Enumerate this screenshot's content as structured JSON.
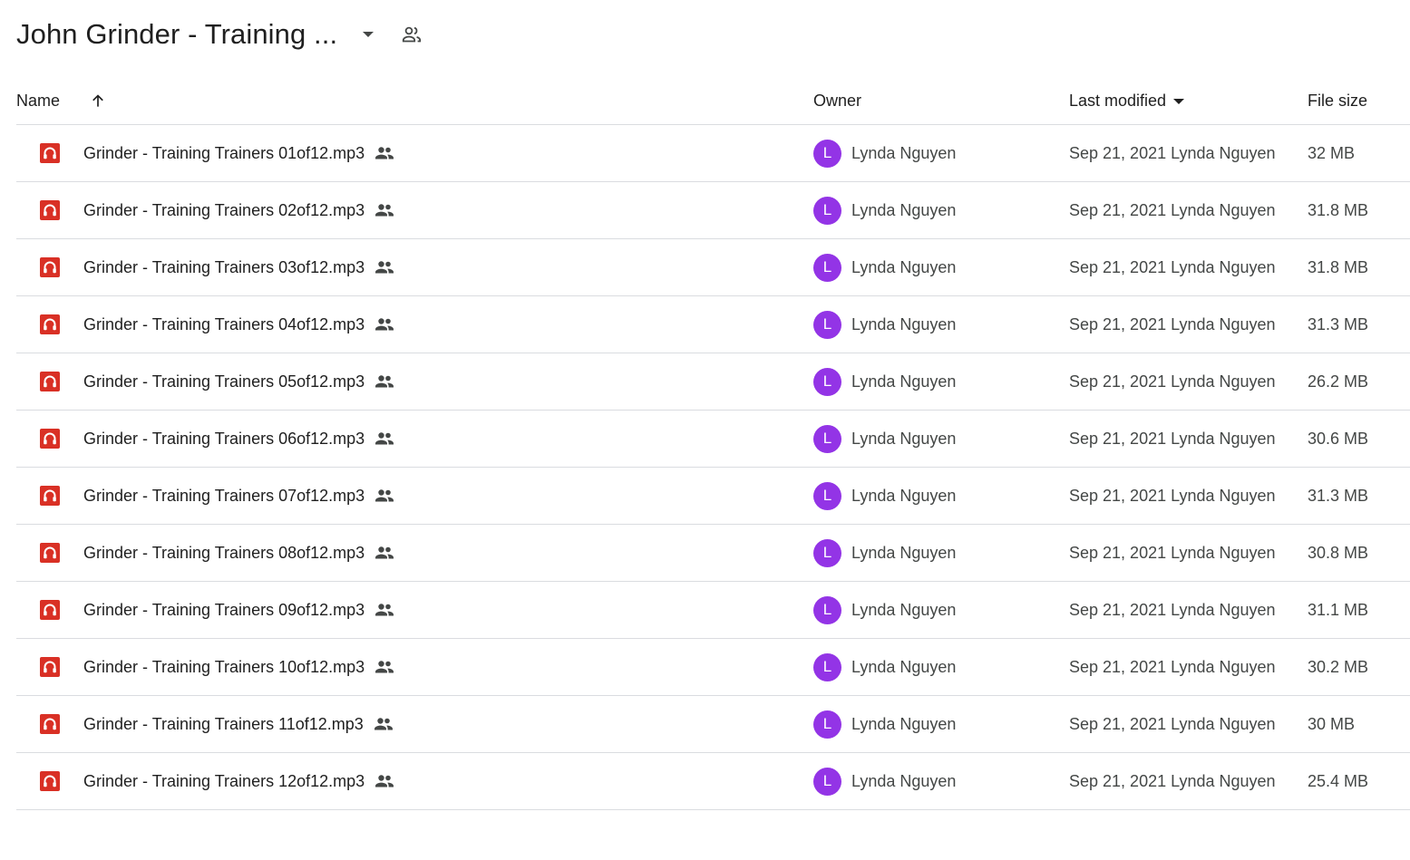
{
  "header": {
    "title": "John Grinder - Training ...",
    "dropdown_icon": "arrow-drop-down-icon",
    "shared_icon": "people-outline-icon"
  },
  "columns": {
    "name": "Name",
    "owner": "Owner",
    "last_modified": "Last modified",
    "file_size": "File size",
    "sort_icon": "arrow-up-icon"
  },
  "colors": {
    "audio_icon": "#d93025",
    "avatar": "#9334e6",
    "divider": "#dadce0"
  },
  "rows": [
    {
      "name": "Grinder - Training Trainers 01of12.mp3",
      "owner_initial": "L",
      "owner": "Lynda Nguyen",
      "modified": "Sep 21, 2021 Lynda Nguyen",
      "size": "32 MB"
    },
    {
      "name": "Grinder - Training Trainers 02of12.mp3",
      "owner_initial": "L",
      "owner": "Lynda Nguyen",
      "modified": "Sep 21, 2021 Lynda Nguyen",
      "size": "31.8 MB"
    },
    {
      "name": "Grinder - Training Trainers 03of12.mp3",
      "owner_initial": "L",
      "owner": "Lynda Nguyen",
      "modified": "Sep 21, 2021 Lynda Nguyen",
      "size": "31.8 MB"
    },
    {
      "name": "Grinder - Training Trainers 04of12.mp3",
      "owner_initial": "L",
      "owner": "Lynda Nguyen",
      "modified": "Sep 21, 2021 Lynda Nguyen",
      "size": "31.3 MB"
    },
    {
      "name": "Grinder - Training Trainers 05of12.mp3",
      "owner_initial": "L",
      "owner": "Lynda Nguyen",
      "modified": "Sep 21, 2021 Lynda Nguyen",
      "size": "26.2 MB"
    },
    {
      "name": "Grinder - Training Trainers 06of12.mp3",
      "owner_initial": "L",
      "owner": "Lynda Nguyen",
      "modified": "Sep 21, 2021 Lynda Nguyen",
      "size": "30.6 MB"
    },
    {
      "name": "Grinder - Training Trainers 07of12.mp3",
      "owner_initial": "L",
      "owner": "Lynda Nguyen",
      "modified": "Sep 21, 2021 Lynda Nguyen",
      "size": "31.3 MB"
    },
    {
      "name": "Grinder - Training Trainers 08of12.mp3",
      "owner_initial": "L",
      "owner": "Lynda Nguyen",
      "modified": "Sep 21, 2021 Lynda Nguyen",
      "size": "30.8 MB"
    },
    {
      "name": "Grinder - Training Trainers 09of12.mp3",
      "owner_initial": "L",
      "owner": "Lynda Nguyen",
      "modified": "Sep 21, 2021 Lynda Nguyen",
      "size": "31.1 MB"
    },
    {
      "name": "Grinder - Training Trainers 10of12.mp3",
      "owner_initial": "L",
      "owner": "Lynda Nguyen",
      "modified": "Sep 21, 2021 Lynda Nguyen",
      "size": "30.2 MB"
    },
    {
      "name": "Grinder - Training Trainers 11of12.mp3",
      "owner_initial": "L",
      "owner": "Lynda Nguyen",
      "modified": "Sep 21, 2021 Lynda Nguyen",
      "size": "30 MB"
    },
    {
      "name": "Grinder - Training Trainers 12of12.mp3",
      "owner_initial": "L",
      "owner": "Lynda Nguyen",
      "modified": "Sep 21, 2021 Lynda Nguyen",
      "size": "25.4 MB"
    }
  ]
}
